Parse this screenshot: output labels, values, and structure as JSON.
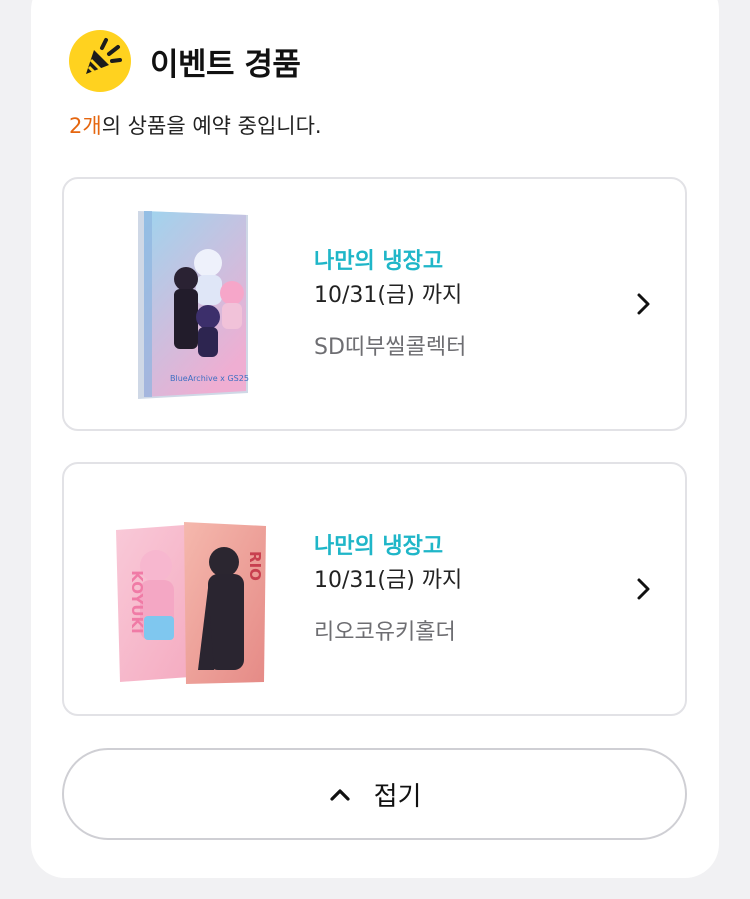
{
  "section": {
    "title": "이벤트 경품",
    "summary_count": "2개",
    "summary_rest": "의 상품을 예약 중입니다.",
    "logo_icon": "party-popper-icon",
    "accent_color": "#ffd21f",
    "count_color": "#e5660f"
  },
  "products": [
    {
      "store": "나만의 냉장고",
      "deadline": "10/31(금) 까지",
      "name": "SD띠부씰콜렉터",
      "image_icon": "sticker-album-image"
    },
    {
      "store": "나만의 냉장고",
      "deadline": "10/31(금) 까지",
      "name": "리오코유키홀더",
      "image_icon": "card-holder-image",
      "image_text_left": "KOYUKI",
      "image_text_right": "RIO"
    }
  ],
  "collapse_button": {
    "label": "접기",
    "icon": "chevron-up-icon"
  },
  "colors": {
    "store_text": "#1fb6c8",
    "card_background": "#ffffff",
    "page_background": "#f1f1f3"
  }
}
